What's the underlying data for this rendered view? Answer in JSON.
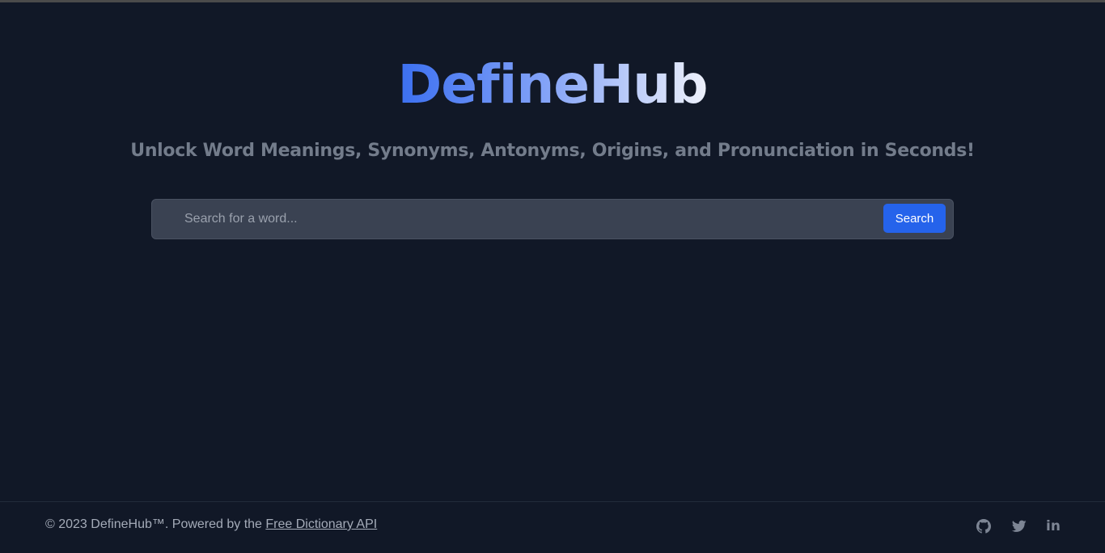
{
  "brand": {
    "name": "DefineHub",
    "gradient": [
      "#3b6ff0",
      "#7e9ff7",
      "#eef1fb"
    ]
  },
  "hero": {
    "tagline": "Unlock Word Meanings, Synonyms, Antonyms, Origins, and Pronunciation in Seconds!"
  },
  "search": {
    "placeholder": "Search for a word...",
    "value": "",
    "button_label": "Search"
  },
  "footer": {
    "copyright": "© 2023 DefineHub™. Powered by the ",
    "api_link_label": "Free Dictionary API",
    "social": [
      {
        "icon": "github-icon"
      },
      {
        "icon": "twitter-icon"
      },
      {
        "icon": "linkedin-icon",
        "label": "in"
      }
    ]
  },
  "colors": {
    "background": "#111827",
    "accent": "#2563eb",
    "tagline": "#737c8b",
    "input_bg": "#3a4252"
  }
}
